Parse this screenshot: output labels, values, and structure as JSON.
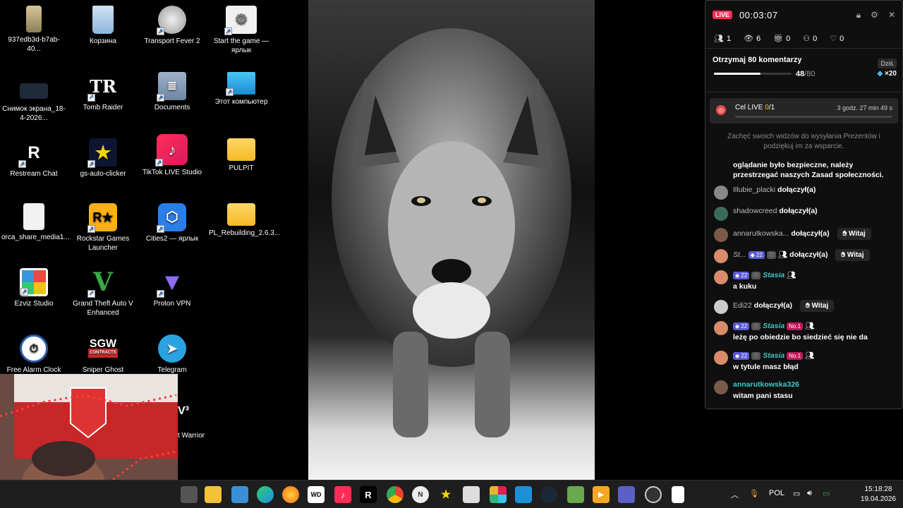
{
  "desktop": {
    "icons": [
      {
        "label": "937edb3d-b7ab-40...",
        "icon": "file-icon"
      },
      {
        "label": "Корзина",
        "icon": "recycle-bin-icon"
      },
      {
        "label": "Transport Fever 2",
        "icon": "transport-fever-icon"
      },
      {
        "label": "Start the game — ярлык",
        "icon": "settings-shortcut-icon"
      },
      {
        "label": "Снимок экрана_18-4-2026...",
        "icon": "screenshot-icon"
      },
      {
        "label": "Tomb Raider",
        "icon": "tomb-raider-icon"
      },
      {
        "label": "Documents",
        "icon": "documents-icon"
      },
      {
        "label": "Этот компьютер",
        "icon": "computer-icon"
      },
      {
        "label": "Restream Chat",
        "icon": "restream-icon"
      },
      {
        "label": "gs-auto-clicker",
        "icon": "auto-clicker-icon"
      },
      {
        "label": "TikTok LIVE Studio",
        "icon": "tiktok-icon"
      },
      {
        "label": "PULPIT",
        "icon": "folder-icon"
      },
      {
        "label": "orca_share_media1...",
        "icon": "file-icon"
      },
      {
        "label": "Rockstar Games Launcher",
        "icon": "rockstar-icon"
      },
      {
        "label": "Cities2 — ярлык",
        "icon": "cities-icon"
      },
      {
        "label": "PL_Rebuilding_2.6.3...",
        "icon": "folder-icon"
      },
      {
        "label": "Ezviz Studio",
        "icon": "ezviz-icon"
      },
      {
        "label": "Grand Theft Auto V Enhanced",
        "icon": "gta-icon"
      },
      {
        "label": "Proton VPN",
        "icon": "proton-vpn-icon"
      },
      {
        "label": "Free Alarm Clock",
        "icon": "alarm-clock-icon"
      },
      {
        "label": "Sniper Ghost Warrior",
        "icon": "sgw-icon"
      },
      {
        "label": "Telegram",
        "icon": "telegram-icon"
      }
    ],
    "icon_glyphs": {
      "tomb_raider": "TR",
      "restream": "R",
      "rockstar": "R★",
      "gta": "V",
      "sgw": "SGW",
      "sgw_sub": "CONTRACTS"
    },
    "partial_label": "t Warrior",
    "partial_glyph": "V³"
  },
  "taskbar": {
    "language": "POL",
    "time": "15:18:28",
    "date": "19.04.2026",
    "apps": [
      "task-view",
      "file-explorer",
      "cortana",
      "edge",
      "firefox",
      "wd",
      "tiktok",
      "restream",
      "chrome",
      "n-app",
      "star-app",
      "box-app",
      "slack",
      "photos",
      "steam",
      "minecraft",
      "media",
      "teams",
      "obs",
      "notepad"
    ]
  },
  "live": {
    "badge": "LIVE",
    "timer": "00:03:07",
    "stats": {
      "viewers": "1",
      "views": "6",
      "gifts": "0",
      "shares": "0",
      "likes": "0"
    },
    "goal": {
      "title": "Otrzymaj 80 komentarzy",
      "today": "Dziś",
      "current": "48",
      "total": "/80",
      "progress": 0.6,
      "reward": "×20"
    },
    "cel": {
      "label": "Cel LIVE ",
      "current": "0",
      "total": "/1",
      "time": "3 godz. 27 min 49 s"
    },
    "encourage": "Zachęć swoich widzów do wysyłania Prezentów i podziękuj im za wsparcie.",
    "rule": "oglądanie było bezpieczne, należy przestrzegać naszych Zasad społeczności.",
    "chat": [
      {
        "user": "Illubie_placki",
        "action": "dołączył(a)"
      },
      {
        "user": "shadowcreed",
        "action": "dołączył(a)"
      },
      {
        "user": "annarutkowska...",
        "action": "dołączył(a)",
        "welcome": "Witaj"
      },
      {
        "user": "St...",
        "level": "22",
        "action": "dołączył(a)",
        "welcome": "Witaj"
      },
      {
        "level": "22",
        "user": "Stasia",
        "text": "a kuku"
      },
      {
        "user": "Edi22",
        "action": "dołączył(a)",
        "welcome": "Witaj"
      },
      {
        "level": "22",
        "user": "Stasia",
        "rank": "No.1",
        "text": "leżę po obiedzie bo siedzieć się nie da"
      },
      {
        "level": "22",
        "user": "Stasia",
        "rank": "No.1",
        "text": "w tytule masz błąd"
      },
      {
        "user": "annarutkowska326",
        "text": "witam pani stasu"
      }
    ]
  },
  "colors": {
    "live_red": "#ff2d55",
    "accent_teal": "#3fc9c6",
    "level_purple": "#5b5bd6",
    "goal_yellow": "#f5c400"
  }
}
